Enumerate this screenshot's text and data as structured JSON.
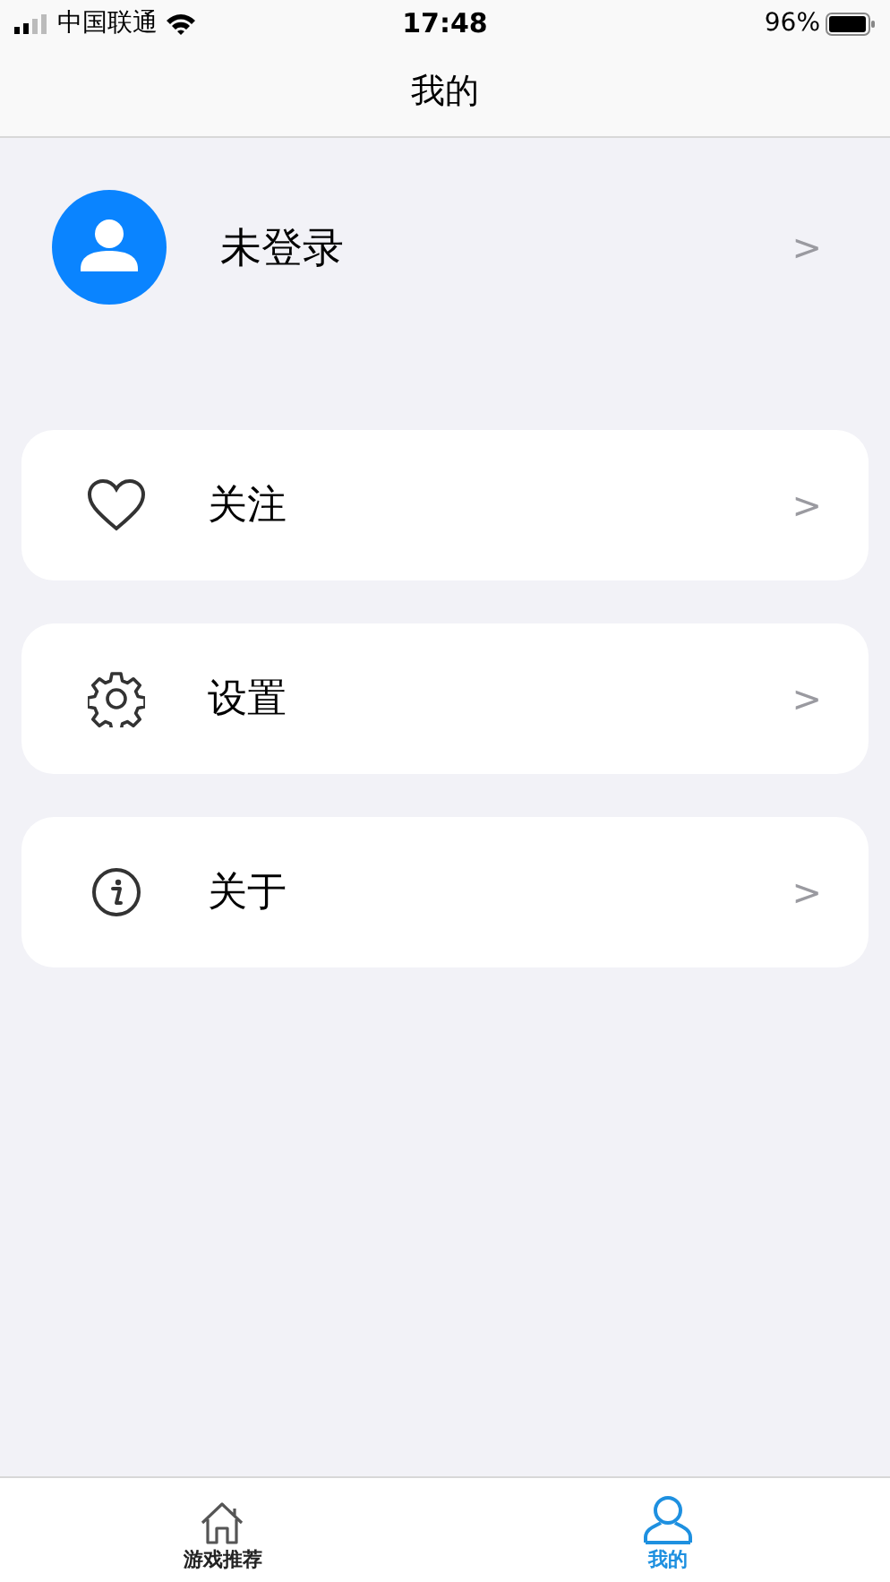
{
  "status_bar": {
    "carrier": "中国联通",
    "time": "17:48",
    "battery": "96%"
  },
  "nav": {
    "title": "我的"
  },
  "profile": {
    "name": "未登录",
    "chevron": ">"
  },
  "menu": [
    {
      "kind": "heart",
      "label": "关注",
      "chevron": ">"
    },
    {
      "kind": "gear",
      "label": "设置",
      "chevron": ">"
    },
    {
      "kind": "info",
      "label": "关于",
      "chevron": ">"
    }
  ],
  "tabs": [
    {
      "kind": "home",
      "label": "游戏推荐",
      "selected": false
    },
    {
      "kind": "person",
      "label": "我的",
      "selected": true
    }
  ]
}
